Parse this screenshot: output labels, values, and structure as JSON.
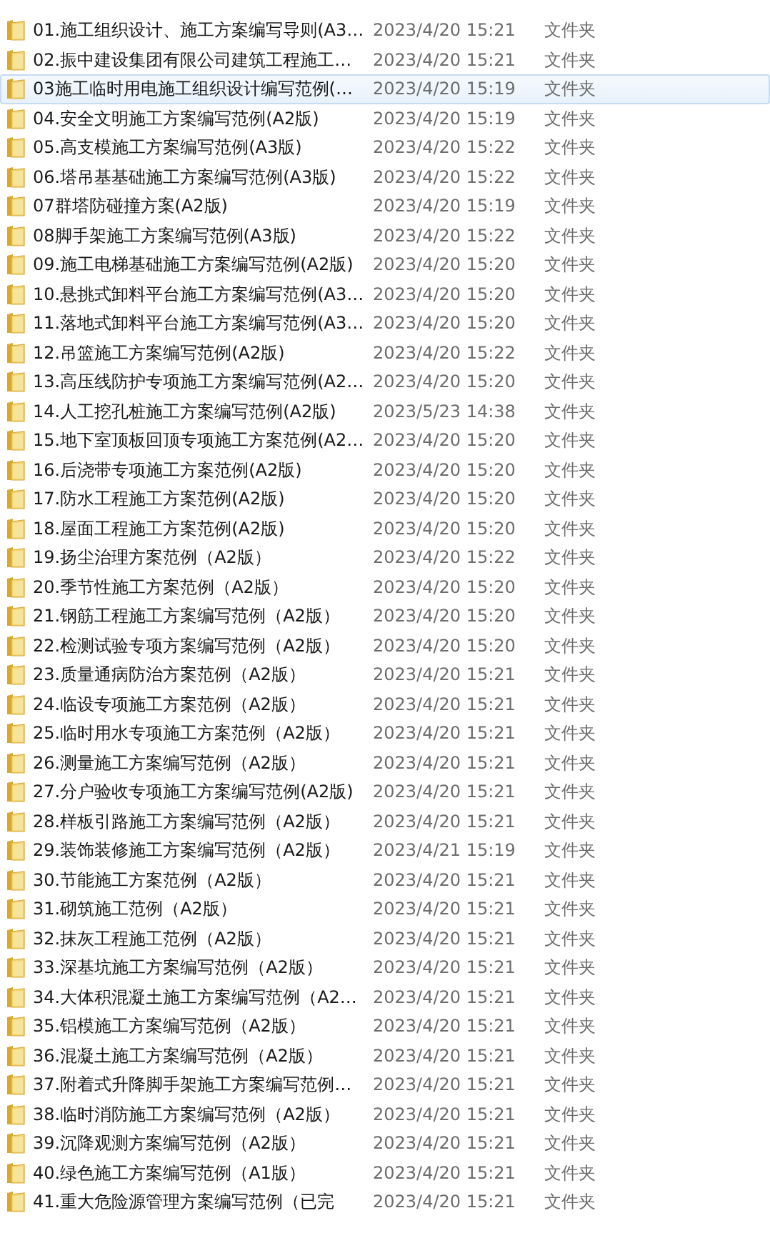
{
  "rows": [
    {
      "name": "01.施工组织设计、施工方案编写导则(A3…",
      "date": "2023/4/20 15:21",
      "type": "文件夹",
      "selected": false
    },
    {
      "name": "02.振中建设集团有限公司建筑工程施工…",
      "date": "2023/4/20 15:21",
      "type": "文件夹",
      "selected": false
    },
    {
      "name": "03施工临时用电施工组织设计编写范例(…",
      "date": "2023/4/20 15:19",
      "type": "文件夹",
      "selected": true
    },
    {
      "name": "04.安全文明施工方案编写范例(A2版)",
      "date": "2023/4/20 15:19",
      "type": "文件夹",
      "selected": false
    },
    {
      "name": "05.高支模施工方案编写范例(A3版)",
      "date": "2023/4/20 15:22",
      "type": "文件夹",
      "selected": false
    },
    {
      "name": "06.塔吊基基础施工方案编写范例(A3版)",
      "date": "2023/4/20 15:22",
      "type": "文件夹",
      "selected": false
    },
    {
      "name": "07群塔防碰撞方案(A2版)",
      "date": "2023/4/20 15:19",
      "type": "文件夹",
      "selected": false
    },
    {
      "name": "08脚手架施工方案编写范例(A3版)",
      "date": "2023/4/20 15:22",
      "type": "文件夹",
      "selected": false
    },
    {
      "name": "09.施工电梯基础施工方案编写范例(A2版)",
      "date": "2023/4/20 15:20",
      "type": "文件夹",
      "selected": false
    },
    {
      "name": "10.悬挑式卸料平台施工方案编写范例(A3…",
      "date": "2023/4/20 15:20",
      "type": "文件夹",
      "selected": false
    },
    {
      "name": "11.落地式卸料平台施工方案编写范例(A3…",
      "date": "2023/4/20 15:20",
      "type": "文件夹",
      "selected": false
    },
    {
      "name": "12.吊篮施工方案编写范例(A2版)",
      "date": "2023/4/20 15:22",
      "type": "文件夹",
      "selected": false
    },
    {
      "name": "13.高压线防护专项施工方案编写范例(A2…",
      "date": "2023/4/20 15:20",
      "type": "文件夹",
      "selected": false
    },
    {
      "name": "14.人工挖孔桩施工方案编写范例(A2版)",
      "date": "2023/5/23 14:38",
      "type": "文件夹",
      "selected": false
    },
    {
      "name": "15.地下室顶板回顶专项施工方案范例(A2…",
      "date": "2023/4/20 15:20",
      "type": "文件夹",
      "selected": false
    },
    {
      "name": "16.后浇带专项施工方案范例(A2版)",
      "date": "2023/4/20 15:20",
      "type": "文件夹",
      "selected": false
    },
    {
      "name": "17.防水工程施工方案范例(A2版)",
      "date": "2023/4/20 15:20",
      "type": "文件夹",
      "selected": false
    },
    {
      "name": "18.屋面工程施工方案范例(A2版)",
      "date": "2023/4/20 15:20",
      "type": "文件夹",
      "selected": false
    },
    {
      "name": "19.扬尘治理方案范例（A2版）",
      "date": "2023/4/20 15:22",
      "type": "文件夹",
      "selected": false
    },
    {
      "name": "20.季节性施工方案范例（A2版）",
      "date": "2023/4/20 15:20",
      "type": "文件夹",
      "selected": false
    },
    {
      "name": "21.钢筋工程施工方案编写范例（A2版）",
      "date": "2023/4/20 15:20",
      "type": "文件夹",
      "selected": false
    },
    {
      "name": "22.检测试验专项方案编写范例（A2版）",
      "date": "2023/4/20 15:20",
      "type": "文件夹",
      "selected": false
    },
    {
      "name": "23.质量通病防治方案范例（A2版）",
      "date": "2023/4/20 15:21",
      "type": "文件夹",
      "selected": false
    },
    {
      "name": "24.临设专项施工方案范例（A2版）",
      "date": "2023/4/20 15:21",
      "type": "文件夹",
      "selected": false
    },
    {
      "name": "25.临时用水专项施工方案范例（A2版）",
      "date": "2023/4/20 15:21",
      "type": "文件夹",
      "selected": false
    },
    {
      "name": "26.测量施工方案编写范例（A2版）",
      "date": "2023/4/20 15:21",
      "type": "文件夹",
      "selected": false
    },
    {
      "name": "27.分户验收专项施工方案编写范例(A2版)",
      "date": "2023/4/20 15:21",
      "type": "文件夹",
      "selected": false
    },
    {
      "name": "28.样板引路施工方案编写范例（A2版）",
      "date": "2023/4/20 15:21",
      "type": "文件夹",
      "selected": false
    },
    {
      "name": "29.装饰装修施工方案编写范例（A2版）",
      "date": "2023/4/21 15:19",
      "type": "文件夹",
      "selected": false
    },
    {
      "name": "30.节能施工方案范例（A2版）",
      "date": "2023/4/20 15:21",
      "type": "文件夹",
      "selected": false
    },
    {
      "name": "31.砌筑施工范例（A2版）",
      "date": "2023/4/20 15:21",
      "type": "文件夹",
      "selected": false
    },
    {
      "name": "32.抹灰工程施工范例（A2版）",
      "date": "2023/4/20 15:21",
      "type": "文件夹",
      "selected": false
    },
    {
      "name": "33.深基坑施工方案编写范例（A2版）",
      "date": "2023/4/20 15:21",
      "type": "文件夹",
      "selected": false
    },
    {
      "name": "34.大体积混凝土施工方案编写范例（A2…",
      "date": "2023/4/20 15:21",
      "type": "文件夹",
      "selected": false
    },
    {
      "name": "35.铝模施工方案编写范例（A2版）",
      "date": "2023/4/20 15:21",
      "type": "文件夹",
      "selected": false
    },
    {
      "name": "36.混凝土施工方案编写范例（A2版）",
      "date": "2023/4/20 15:21",
      "type": "文件夹",
      "selected": false
    },
    {
      "name": "37.附着式升降脚手架施工方案编写范例…",
      "date": "2023/4/20 15:21",
      "type": "文件夹",
      "selected": false
    },
    {
      "name": "38.临时消防施工方案编写范例（A2版）",
      "date": "2023/4/20 15:21",
      "type": "文件夹",
      "selected": false
    },
    {
      "name": "39.沉降观测方案编写范例（A2版）",
      "date": "2023/4/20 15:21",
      "type": "文件夹",
      "selected": false
    },
    {
      "name": "40.绿色施工方案编写范例（A1版）",
      "date": "2023/4/20 15:21",
      "type": "文件夹",
      "selected": false
    },
    {
      "name": "41.重大危险源管理方案编写范例（已完",
      "date": "2023/4/20 15:21",
      "type": "文件夹",
      "selected": false
    }
  ]
}
